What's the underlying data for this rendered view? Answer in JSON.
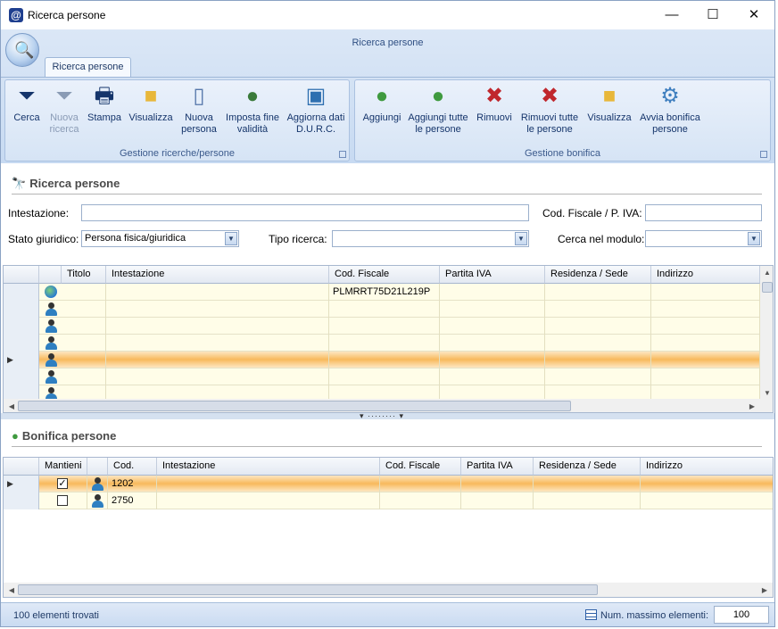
{
  "window": {
    "title": "Ricerca persone",
    "minimize": "—",
    "maximize": "☐",
    "close": "✕",
    "app_icon": "@"
  },
  "ribbon": {
    "caption": "Ricerca persone",
    "tab": "Ricerca persone",
    "group1": {
      "label": "Gestione ricerche/persone",
      "buttons": [
        {
          "label1": "Cerca",
          "label2": "",
          "icon": "funnel-icon"
        },
        {
          "label1": "Nuova",
          "label2": "ricerca",
          "icon": "funnel-clear-icon",
          "disabled": true
        },
        {
          "label1": "Stampa",
          "label2": "",
          "icon": "printer-icon"
        },
        {
          "label1": "Visualizza",
          "label2": "",
          "icon": "folder-icon"
        },
        {
          "label1": "Nuova",
          "label2": "persona",
          "icon": "new-document-icon"
        },
        {
          "label1": "Imposta fine",
          "label2": "validità",
          "icon": "person-trash-icon"
        },
        {
          "label1": "Aggiorna dati",
          "label2": "D.U.R.C.",
          "icon": "person-document-icon"
        }
      ]
    },
    "group2": {
      "label": "Gestione bonifica",
      "buttons": [
        {
          "label1": "Aggiungi",
          "label2": "",
          "icon": "person-add-icon"
        },
        {
          "label1": "Aggiungi tutte",
          "label2": "le persone",
          "icon": "persons-add-icon"
        },
        {
          "label1": "Rimuovi",
          "label2": "",
          "icon": "person-remove-icon"
        },
        {
          "label1": "Rimuovi tutte",
          "label2": "le persone",
          "icon": "persons-remove-icon"
        },
        {
          "label1": "Visualizza",
          "label2": "",
          "icon": "folder-icon"
        },
        {
          "label1": "Avvia bonifica",
          "label2": "persone",
          "icon": "gear-arrow-icon"
        }
      ]
    }
  },
  "search": {
    "header": "Ricerca persone",
    "intestazione_label": "Intestazione:",
    "intestazione_value": "",
    "codfisc_label": "Cod. Fiscale / P. IVA:",
    "codfisc_value": "",
    "stato_label": "Stato giuridico:",
    "stato_value": "Persona fisica/giuridica",
    "tipo_label": "Tipo ricerca:",
    "tipo_value": "",
    "modulo_label": "Cerca nel modulo:",
    "modulo_value": ""
  },
  "results_grid": {
    "columns": [
      "Titolo",
      "Intestazione",
      "Cod. Fiscale",
      "Partita IVA",
      "Residenza / Sede",
      "Indirizzo"
    ],
    "rows": [
      {
        "icon": "globe-icon",
        "titolo": "",
        "intestazione": "",
        "cod_fiscale": "PLMRRT75D21L219P",
        "partita_iva": "",
        "residenza": "",
        "indirizzo": ""
      },
      {
        "icon": "person-icon",
        "titolo": "",
        "intestazione": "",
        "cod_fiscale": "",
        "partita_iva": "",
        "residenza": "",
        "indirizzo": ""
      },
      {
        "icon": "person-icon",
        "titolo": "",
        "intestazione": "",
        "cod_fiscale": "",
        "partita_iva": "",
        "residenza": "",
        "indirizzo": ""
      },
      {
        "icon": "person-icon",
        "titolo": "",
        "intestazione": "",
        "cod_fiscale": "",
        "partita_iva": "",
        "residenza": "",
        "indirizzo": ""
      },
      {
        "icon": "person-icon",
        "titolo": "",
        "intestazione": "",
        "cod_fiscale": "",
        "partita_iva": "",
        "residenza": "",
        "indirizzo": "",
        "selected": true
      },
      {
        "icon": "person-icon",
        "titolo": "",
        "intestazione": "",
        "cod_fiscale": "",
        "partita_iva": "",
        "residenza": "",
        "indirizzo": ""
      },
      {
        "icon": "person-icon",
        "titolo": "",
        "intestazione": "",
        "cod_fiscale": "",
        "partita_iva": "",
        "residenza": "",
        "indirizzo": ""
      }
    ]
  },
  "bonifica": {
    "header": "Bonifica persone",
    "columns": [
      "Mantieni",
      "",
      "Cod.",
      "Intestazione",
      "Cod. Fiscale",
      "Partita IVA",
      "Residenza / Sede",
      "Indirizzo"
    ],
    "rows": [
      {
        "mantieni": true,
        "icon": "person-icon",
        "cod": "1202",
        "intestazione": "",
        "cod_fiscale": "",
        "partita_iva": "",
        "residenza": "",
        "indirizzo": "",
        "selected": true
      },
      {
        "mantieni": false,
        "icon": "person-icon",
        "cod": "2750",
        "intestazione": "",
        "cod_fiscale": "",
        "partita_iva": "",
        "residenza": "",
        "indirizzo": ""
      }
    ]
  },
  "status": {
    "found": "100 elementi trovati",
    "max_label": "Num. massimo elementi:",
    "max_value": "100"
  },
  "colors": {
    "accent": "#c7daf2",
    "selected_row": "#f8b95c",
    "row_bg": "#fffde8"
  }
}
